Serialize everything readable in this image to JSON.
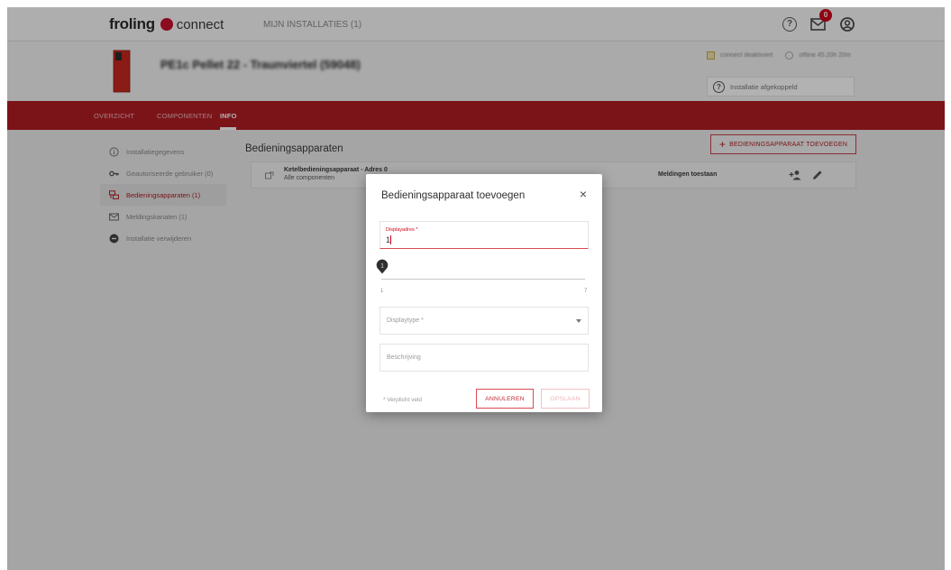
{
  "topbar": {
    "brand_name": "froling",
    "brand_suffix": "connect",
    "nav_installations": "MIJN INSTALLATIES (1)",
    "help_icon": "question-circle-icon",
    "mail_icon": "mail-icon",
    "mail_badge": "0",
    "user_icon": "user-circle-icon"
  },
  "header": {
    "installation_title": "PE1c Pellet 22 - Traunviertel (59048)",
    "installation_subtitle": "",
    "connect_status": "connect deaktiviert",
    "online_status": "offline 45.20h 20m",
    "disconnected_label": "Installatie afgekoppeld"
  },
  "tabs": [
    {
      "label": "OVERZICHT",
      "active": false
    },
    {
      "label": "COMPONENTEN",
      "active": false
    },
    {
      "label": "INFO",
      "active": true
    }
  ],
  "sidebar": {
    "items": [
      {
        "label": "Installatiegegevens",
        "icon": "info-circle-icon",
        "active": false
      },
      {
        "label": "Geautoriseerde gebruiker (0)",
        "icon": "key-icon",
        "active": false
      },
      {
        "label": "Bedieningsapparaten (1)",
        "icon": "control-devices-icon",
        "active": true
      },
      {
        "label": "Meldingskanalen (1)",
        "icon": "mail-icon",
        "active": false
      },
      {
        "label": "Installatie verwijderen",
        "icon": "remove-circle-icon",
        "active": false
      }
    ]
  },
  "main": {
    "title": "Bedieningsapparaten",
    "add_button": "BEDIENINGSAPPARAAT TOEVOEGEN",
    "device": {
      "title": "Ketelbedieningsapparaat - Adres 0",
      "subtitle": "Alle componenten",
      "notifications": "Meldingen toestaan"
    }
  },
  "modal": {
    "title": "Bedieningsapparaat toevoegen",
    "address_label": "Displayadres *",
    "address_value": "1",
    "slider_value": "1",
    "slider_min": "1",
    "slider_max": "7",
    "type_placeholder": "Displaytype *",
    "description_placeholder": "Beschrijving",
    "required_note": "* Verplicht veld",
    "cancel_label": "ANNULEREN",
    "save_label": "OPSLAAN"
  },
  "colors": {
    "brand_red": "#b01e24",
    "accent_red": "#d0021b"
  }
}
